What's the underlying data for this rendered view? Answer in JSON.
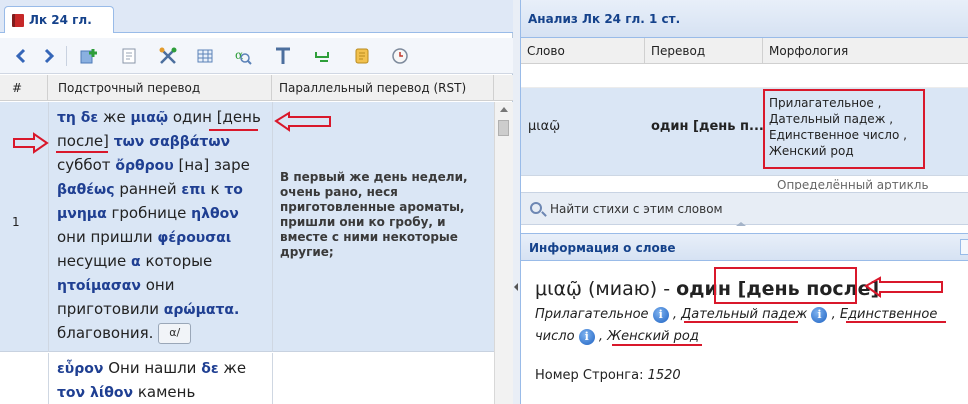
{
  "left_panel": {
    "tab_label": "Лк 24 гл.",
    "columns": {
      "num": "#",
      "interlinear": "Подстрочный перевод",
      "parallel": "Параллельный перевод (RST)"
    },
    "rows": [
      {
        "num": "1",
        "words": [
          {
            "greek": "τη δε",
            "rus": "же"
          },
          {
            "greek": "μιαῷ",
            "rus": "один [день после]"
          },
          {
            "greek": "των σαββάτων",
            "rus": "суббот"
          },
          {
            "greek": "ὄρθρου",
            "rus": "[на] заре"
          },
          {
            "greek": "βαθέως",
            "rus": "ранней"
          },
          {
            "greek": "επι",
            "rus": "к"
          },
          {
            "greek": "το μνημα",
            "rus": "гробнице"
          },
          {
            "greek": "ηλθον",
            "rus": "они пришли"
          },
          {
            "greek": "φέρουσαι",
            "rus": "несущие"
          },
          {
            "greek": "α",
            "rus": "которые"
          },
          {
            "greek": "ητοίμασαν",
            "rus": "они приготовили"
          },
          {
            "greek": "αρώματα.",
            "rus": "благовония."
          }
        ],
        "strong_button": "α/",
        "parallel": "В первый же день недели, очень рано, неся приготовленные ароматы, пришли они ко гробу, и вместе с ними некоторые другие;"
      },
      {
        "words_line1": {
          "greek": "εὗρον",
          "rus": "Они нашли"
        },
        "words_line1b": {
          "greek": "δε",
          "rus": "же"
        },
        "words_line2": {
          "greek": "τον λίθον",
          "rus": "камень"
        }
      }
    ]
  },
  "analysis": {
    "title": "Анализ Лк 24 гл. 1 ст.",
    "columns": {
      "word": "Слово",
      "translation": "Перевод",
      "morphology": "Морфология"
    },
    "selected_row": {
      "word": "μιαῷ",
      "translation": "один [день п...",
      "morph_lines": [
        "Прилагательное ,",
        "Дательный падеж  ,",
        "Единственное число  ,",
        "Женский род"
      ]
    },
    "next_row_partial": "Определённый артикль",
    "find_button": "Найти стихи с этим словом"
  },
  "word_info": {
    "title": "Информация о слове",
    "greek": "μιαῷ",
    "translit": "(миаю)",
    "dash": "-",
    "meaning": "один [день после]",
    "morph": {
      "adj": "Прилагательное",
      "case": "Дательный падеж",
      "number_a": "Единственное",
      "number_b": "число",
      "gender": "Женский род",
      "sep": ","
    },
    "strong_label": "Номер Стронга:",
    "strong_value": "1520"
  },
  "annotation_color": "#d9182b"
}
